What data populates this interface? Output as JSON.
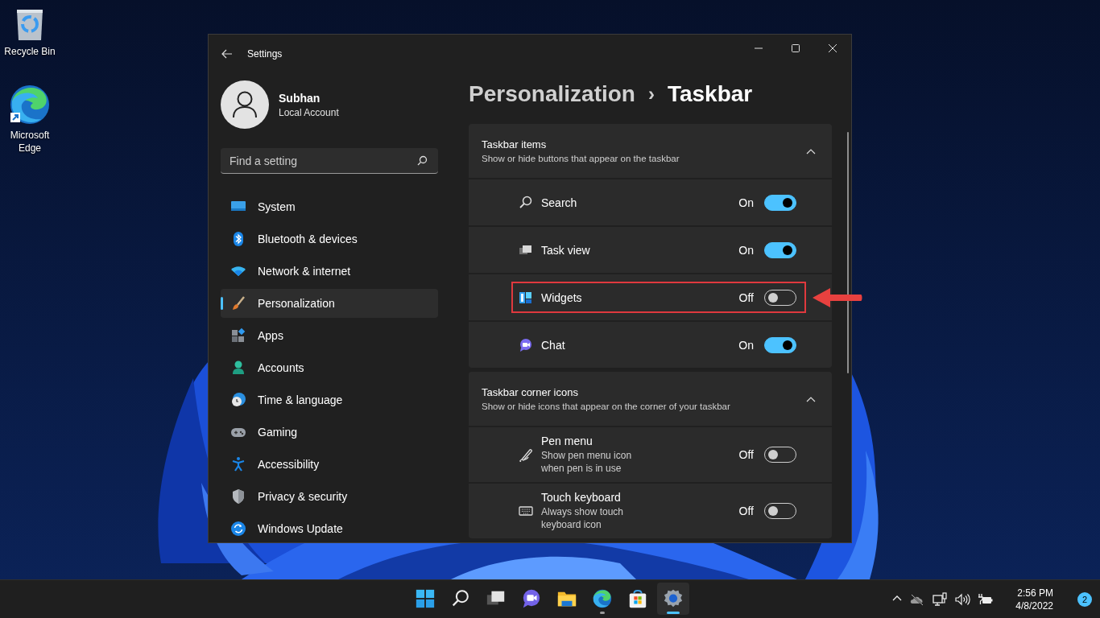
{
  "desktop_icons": [
    {
      "label": "Recycle Bin"
    },
    {
      "label": "Microsoft Edge"
    }
  ],
  "window": {
    "title": "Settings"
  },
  "user": {
    "name": "Subhan",
    "account": "Local Account"
  },
  "search": {
    "placeholder": "Find a setting"
  },
  "nav": [
    {
      "label": "System",
      "selected": false
    },
    {
      "label": "Bluetooth & devices",
      "selected": false
    },
    {
      "label": "Network & internet",
      "selected": false
    },
    {
      "label": "Personalization",
      "selected": true
    },
    {
      "label": "Apps",
      "selected": false
    },
    {
      "label": "Accounts",
      "selected": false
    },
    {
      "label": "Time & language",
      "selected": false
    },
    {
      "label": "Gaming",
      "selected": false
    },
    {
      "label": "Accessibility",
      "selected": false
    },
    {
      "label": "Privacy & security",
      "selected": false
    },
    {
      "label": "Windows Update",
      "selected": false
    }
  ],
  "breadcrumb": {
    "parent": "Personalization",
    "separator": "›",
    "current": "Taskbar"
  },
  "sections": [
    {
      "title": "Taskbar items",
      "subtitle": "Show or hide buttons that appear on the taskbar",
      "expanded": true,
      "items": [
        {
          "label": "Search",
          "state_label": "On",
          "on": true,
          "highlighted": false
        },
        {
          "label": "Task view",
          "state_label": "On",
          "on": true,
          "highlighted": false
        },
        {
          "label": "Widgets",
          "state_label": "Off",
          "on": false,
          "highlighted": true
        },
        {
          "label": "Chat",
          "state_label": "On",
          "on": true,
          "highlighted": false
        }
      ]
    },
    {
      "title": "Taskbar corner icons",
      "subtitle": "Show or hide icons that appear on the corner of your taskbar",
      "expanded": true,
      "items": [
        {
          "label": "Pen menu",
          "description": "Show pen menu icon when pen is in use",
          "state_label": "Off",
          "on": false,
          "highlighted": false
        },
        {
          "label": "Touch keyboard",
          "description": "Always show touch keyboard icon",
          "state_label": "Off",
          "on": false,
          "highlighted": false
        }
      ]
    }
  ],
  "taskbar": {
    "apps": [
      {
        "running": false,
        "selected": false
      },
      {
        "running": false,
        "selected": false
      },
      {
        "running": false,
        "selected": false
      },
      {
        "running": false,
        "selected": false
      },
      {
        "running": false,
        "selected": false
      },
      {
        "running": true,
        "selected": false
      },
      {
        "running": false,
        "selected": false
      },
      {
        "running": true,
        "selected": true
      }
    ],
    "time": "2:56 PM",
    "date": "4/8/2022",
    "notifications": "2"
  }
}
